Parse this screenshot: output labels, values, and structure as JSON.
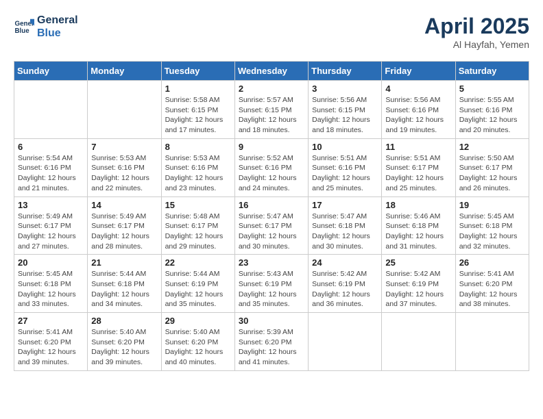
{
  "logo": {
    "line1": "General",
    "line2": "Blue"
  },
  "title": "April 2025",
  "subtitle": "Al Hayfah, Yemen",
  "weekdays": [
    "Sunday",
    "Monday",
    "Tuesday",
    "Wednesday",
    "Thursday",
    "Friday",
    "Saturday"
  ],
  "weeks": [
    [
      {
        "day": "",
        "info": ""
      },
      {
        "day": "",
        "info": ""
      },
      {
        "day": "1",
        "info": "Sunrise: 5:58 AM\nSunset: 6:15 PM\nDaylight: 12 hours and 17 minutes."
      },
      {
        "day": "2",
        "info": "Sunrise: 5:57 AM\nSunset: 6:15 PM\nDaylight: 12 hours and 18 minutes."
      },
      {
        "day": "3",
        "info": "Sunrise: 5:56 AM\nSunset: 6:15 PM\nDaylight: 12 hours and 18 minutes."
      },
      {
        "day": "4",
        "info": "Sunrise: 5:56 AM\nSunset: 6:16 PM\nDaylight: 12 hours and 19 minutes."
      },
      {
        "day": "5",
        "info": "Sunrise: 5:55 AM\nSunset: 6:16 PM\nDaylight: 12 hours and 20 minutes."
      }
    ],
    [
      {
        "day": "6",
        "info": "Sunrise: 5:54 AM\nSunset: 6:16 PM\nDaylight: 12 hours and 21 minutes."
      },
      {
        "day": "7",
        "info": "Sunrise: 5:53 AM\nSunset: 6:16 PM\nDaylight: 12 hours and 22 minutes."
      },
      {
        "day": "8",
        "info": "Sunrise: 5:53 AM\nSunset: 6:16 PM\nDaylight: 12 hours and 23 minutes."
      },
      {
        "day": "9",
        "info": "Sunrise: 5:52 AM\nSunset: 6:16 PM\nDaylight: 12 hours and 24 minutes."
      },
      {
        "day": "10",
        "info": "Sunrise: 5:51 AM\nSunset: 6:16 PM\nDaylight: 12 hours and 25 minutes."
      },
      {
        "day": "11",
        "info": "Sunrise: 5:51 AM\nSunset: 6:17 PM\nDaylight: 12 hours and 25 minutes."
      },
      {
        "day": "12",
        "info": "Sunrise: 5:50 AM\nSunset: 6:17 PM\nDaylight: 12 hours and 26 minutes."
      }
    ],
    [
      {
        "day": "13",
        "info": "Sunrise: 5:49 AM\nSunset: 6:17 PM\nDaylight: 12 hours and 27 minutes."
      },
      {
        "day": "14",
        "info": "Sunrise: 5:49 AM\nSunset: 6:17 PM\nDaylight: 12 hours and 28 minutes."
      },
      {
        "day": "15",
        "info": "Sunrise: 5:48 AM\nSunset: 6:17 PM\nDaylight: 12 hours and 29 minutes."
      },
      {
        "day": "16",
        "info": "Sunrise: 5:47 AM\nSunset: 6:17 PM\nDaylight: 12 hours and 30 minutes."
      },
      {
        "day": "17",
        "info": "Sunrise: 5:47 AM\nSunset: 6:18 PM\nDaylight: 12 hours and 30 minutes."
      },
      {
        "day": "18",
        "info": "Sunrise: 5:46 AM\nSunset: 6:18 PM\nDaylight: 12 hours and 31 minutes."
      },
      {
        "day": "19",
        "info": "Sunrise: 5:45 AM\nSunset: 6:18 PM\nDaylight: 12 hours and 32 minutes."
      }
    ],
    [
      {
        "day": "20",
        "info": "Sunrise: 5:45 AM\nSunset: 6:18 PM\nDaylight: 12 hours and 33 minutes."
      },
      {
        "day": "21",
        "info": "Sunrise: 5:44 AM\nSunset: 6:18 PM\nDaylight: 12 hours and 34 minutes."
      },
      {
        "day": "22",
        "info": "Sunrise: 5:44 AM\nSunset: 6:19 PM\nDaylight: 12 hours and 35 minutes."
      },
      {
        "day": "23",
        "info": "Sunrise: 5:43 AM\nSunset: 6:19 PM\nDaylight: 12 hours and 35 minutes."
      },
      {
        "day": "24",
        "info": "Sunrise: 5:42 AM\nSunset: 6:19 PM\nDaylight: 12 hours and 36 minutes."
      },
      {
        "day": "25",
        "info": "Sunrise: 5:42 AM\nSunset: 6:19 PM\nDaylight: 12 hours and 37 minutes."
      },
      {
        "day": "26",
        "info": "Sunrise: 5:41 AM\nSunset: 6:20 PM\nDaylight: 12 hours and 38 minutes."
      }
    ],
    [
      {
        "day": "27",
        "info": "Sunrise: 5:41 AM\nSunset: 6:20 PM\nDaylight: 12 hours and 39 minutes."
      },
      {
        "day": "28",
        "info": "Sunrise: 5:40 AM\nSunset: 6:20 PM\nDaylight: 12 hours and 39 minutes."
      },
      {
        "day": "29",
        "info": "Sunrise: 5:40 AM\nSunset: 6:20 PM\nDaylight: 12 hours and 40 minutes."
      },
      {
        "day": "30",
        "info": "Sunrise: 5:39 AM\nSunset: 6:20 PM\nDaylight: 12 hours and 41 minutes."
      },
      {
        "day": "",
        "info": ""
      },
      {
        "day": "",
        "info": ""
      },
      {
        "day": "",
        "info": ""
      }
    ]
  ]
}
